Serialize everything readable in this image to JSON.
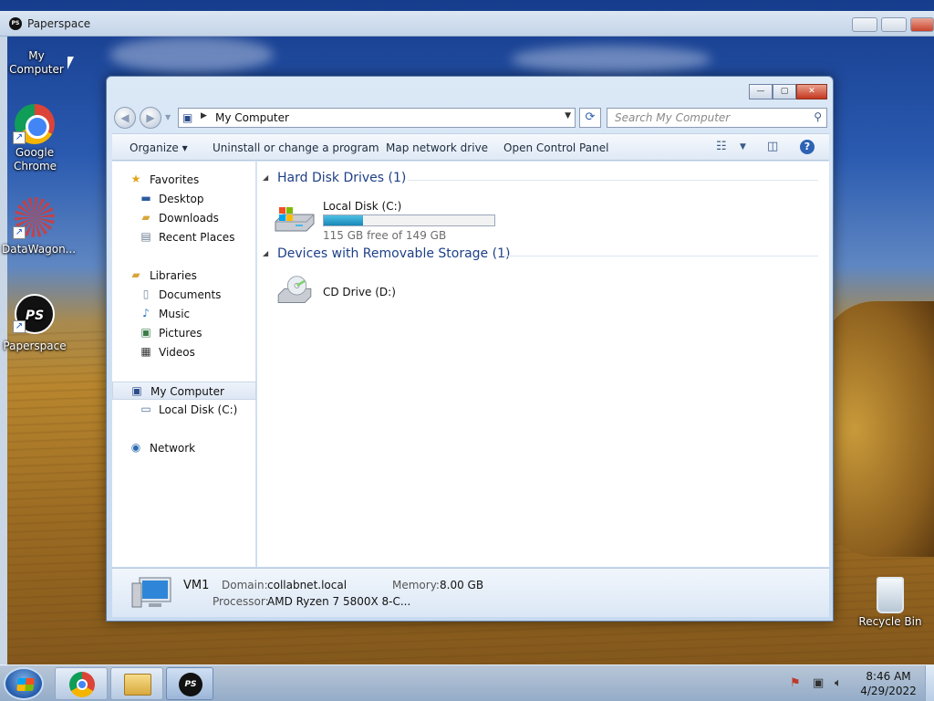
{
  "outer_window": {
    "title": "Paperspace",
    "logo_text": "PS"
  },
  "desktop": {
    "icons": [
      {
        "label": "My Computer"
      },
      {
        "label": "Google Chrome"
      },
      {
        "label": "DataWagon..."
      },
      {
        "label": "Paperspace",
        "logo_text": "PS"
      },
      {
        "label": "Recycle Bin"
      }
    ]
  },
  "explorer": {
    "address": {
      "breadcrumb": "My Computer"
    },
    "search": {
      "placeholder": "Search My Computer"
    },
    "toolbar": {
      "organize": "Organize",
      "uninstall": "Uninstall or change a program",
      "map_drive": "Map network drive",
      "control_panel": "Open Control Panel"
    },
    "nav_pane": {
      "favorites": "Favorites",
      "desktop": "Desktop",
      "downloads": "Downloads",
      "recent_places": "Recent Places",
      "libraries": "Libraries",
      "documents": "Documents",
      "music": "Music",
      "pictures": "Pictures",
      "videos": "Videos",
      "my_computer": "My Computer",
      "local_disk": "Local Disk (C:)",
      "network": "Network"
    },
    "groups": {
      "hard_disks": {
        "header": "Hard Disk Drives (1)",
        "drive_name": "Local Disk (C:)",
        "free_text": "115 GB free of 149 GB",
        "used_fraction": 0.23
      },
      "removable": {
        "header": "Devices with Removable Storage (1)",
        "drive_name": "CD Drive (D:)"
      }
    },
    "details": {
      "computer_name": "VM1",
      "domain_label": "Domain:",
      "domain_value": "collabnet.local",
      "memory_label": "Memory:",
      "memory_value": "8.00 GB",
      "processor_label": "Processor:",
      "processor_value": "AMD Ryzen 7 5800X 8-C..."
    }
  },
  "taskbar": {
    "ps_text": "PS",
    "time": "8:46 AM",
    "date": "4/29/2022"
  },
  "colors": {
    "accent": "#1e3f87",
    "progress": "#1787b8"
  }
}
